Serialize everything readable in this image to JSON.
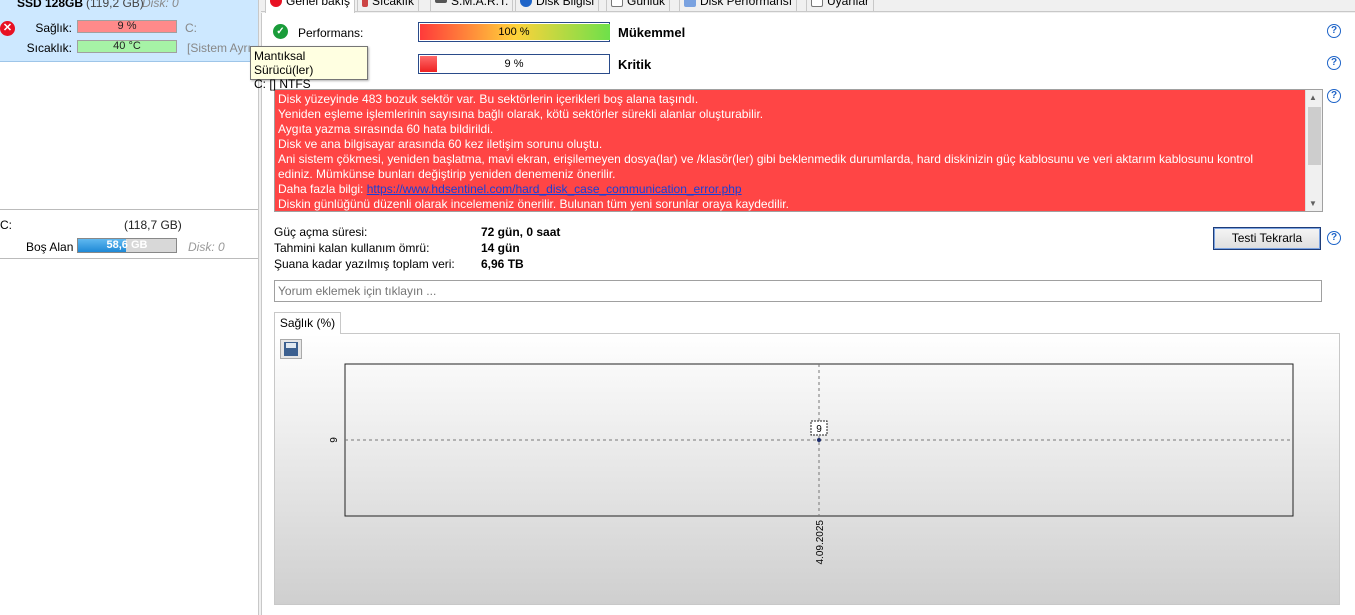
{
  "left": {
    "disk": {
      "title": "SSD 128GB",
      "size": "(119,2 GB)",
      "disk_num": "Disk: 0",
      "health_label": "Sağlık:",
      "health_value": "9 %",
      "health_fraction": 0.09,
      "temp_label": "Sıcaklık:",
      "temp_value": "40 °C",
      "volume_letter": "C:",
      "system_reserved": "[Sistem Ayrı",
      "error_icon": "error-x-icon"
    },
    "volume": {
      "letter": "C:",
      "size": "(118,7 GB)",
      "free_label": "Boş Alan",
      "free_value": "58,6 GB",
      "free_fraction": 0.49,
      "disk_num": "Disk: 0"
    }
  },
  "tooltip": {
    "line1": "Mantıksal Sürücü(ler)",
    "line2": "C: [] NTFS"
  },
  "tabs": [
    {
      "label": "Genel bakış",
      "icon": "error-x-icon",
      "active": true
    },
    {
      "label": "Sıcaklık",
      "icon": "thermometer-icon"
    },
    {
      "label": "S.M.A.R.T.",
      "icon": "drive-icon"
    },
    {
      "label": "Disk Bilgisi",
      "icon": "info-icon"
    },
    {
      "label": "Günlük",
      "icon": "document-icon"
    },
    {
      "label": "Disk Performansı",
      "icon": "chart-icon"
    },
    {
      "label": "Uyarılar",
      "icon": "warning-icon"
    }
  ],
  "overview": {
    "performance_label": "Performans:",
    "performance_value": "100 %",
    "performance_fraction": 1.0,
    "performance_word": "Mükemmel",
    "health_value": "9 %",
    "health_fraction": 0.09,
    "health_word": "Kritik",
    "colors": {
      "critical": "#ff4545",
      "link": "#1740d8"
    },
    "message_lines": [
      "Disk yüzeyinde 483 bozuk sektör var. Bu sektörlerin içerikleri boş alana taşındı.",
      "Yeniden eşleme işlemlerinin sayısına bağlı olarak, kötü sektörler sürekli alanlar oluşturabilir.",
      "Aygıta yazma sırasında 60 hata bildirildi.",
      "Disk ve ana bilgisayar arasında 60 kez iletişim sorunu oluştu.",
      "Ani sistem çökmesi, yeniden başlatma, mavi ekran, erişilemeyen dosya(lar) ve /klasör(ler) gibi beklenmedik durumlarda, hard diskinizin güç kablosunu ve veri aktarım kablosunu kontrol",
      "ediniz. Mümkünse bunları değiştirip yeniden denemeniz önerilir."
    ],
    "more_info_label": "Daha fazla bilgi: ",
    "more_info_link": "https://www.hdsentinel.com/hard_disk_case_communication_error.php",
    "message_last": "Diskin günlüğünü düzenli olarak incelemeniz önerilir. Bulunan tüm yeni sorunlar oraya kaydedilir.",
    "stats": [
      {
        "label": "Güç açma süresi:",
        "value": "72 gün, 0 saat"
      },
      {
        "label": "Tahmini kalan kullanım ömrü:",
        "value": "14 gün"
      },
      {
        "label": "Şuana kadar yazılmış toplam veri:",
        "value": "6,96 TB"
      }
    ],
    "retest_label": "Testi Tekrarla",
    "comment_placeholder": "Yorum eklemek için tıklayın ...",
    "chart_tab_label": "Sağlık (%)"
  },
  "chart_data": {
    "type": "line",
    "x": [
      "4.09.2025"
    ],
    "series": [
      {
        "values": [
          9
        ]
      }
    ],
    "y_tick_labels": [
      "9"
    ],
    "point_labels": [
      "9"
    ],
    "grid": true
  }
}
